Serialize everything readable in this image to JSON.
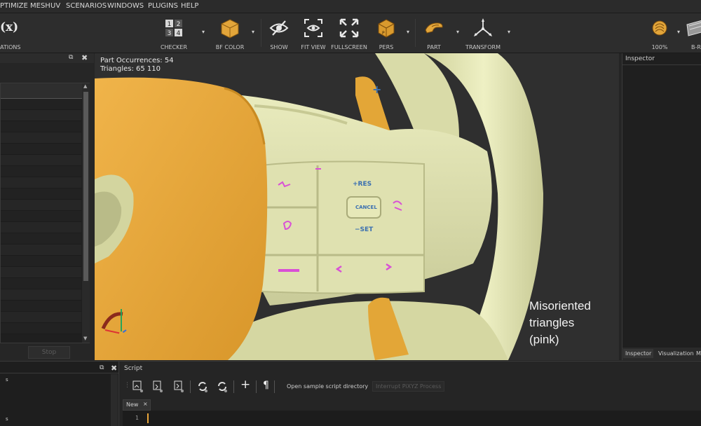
{
  "menu": [
    "PTIMIZE MESH",
    "UV",
    "SCENARIOS",
    "WINDOWS",
    "PLUGINS",
    "HELP"
  ],
  "toolbar": {
    "left_label": "ATIONS",
    "left_icon_text": "(x)",
    "buttons": [
      {
        "label": "CHECKER",
        "icon": "checker-icon",
        "digits": [
          "1",
          "2",
          "3",
          "4"
        ]
      },
      {
        "label": "BF COLOR",
        "icon": "bf-color-cube-icon"
      },
      {
        "label": "SHOW",
        "icon": "eye-slash-icon"
      },
      {
        "label": "FIT VIEW",
        "icon": "fit-view-eye-icon"
      },
      {
        "label": "FULLSCREEN",
        "icon": "fullscreen-arrows-icon"
      },
      {
        "label": "PERS",
        "icon": "perspective-cube-icon"
      },
      {
        "label": "PART",
        "icon": "part-icon"
      },
      {
        "label": "TRANSFORM",
        "icon": "transform-gizmo-icon"
      }
    ],
    "zoom_label": "100%",
    "right_label": "B-R"
  },
  "left_panel": {
    "stop_button": "Stop"
  },
  "viewport": {
    "occurrences": "Part Occurrences: 54",
    "triangles": "Triangles: 65 110",
    "annotation": [
      "Misoriented",
      "triangles",
      "(pink)"
    ],
    "button_labels": {
      "res": "+RES",
      "cancel": "CANCEL",
      "set": "−SET"
    }
  },
  "inspector": {
    "title": "Inspector",
    "tabs": [
      "Inspector",
      "Visualization",
      "M"
    ]
  },
  "script": {
    "title": "Script",
    "open_sample": "Open sample script directory",
    "interrupt": "Interrupt PiXYZ Process",
    "tab": "New",
    "tab_close": "×",
    "line_number": "1",
    "left_output": [
      "s",
      "s"
    ]
  },
  "colors": {
    "steering": "#e6e8b6",
    "airbag": "#e7a837",
    "pink": "#d950d6",
    "background": "#2f2f2f"
  }
}
